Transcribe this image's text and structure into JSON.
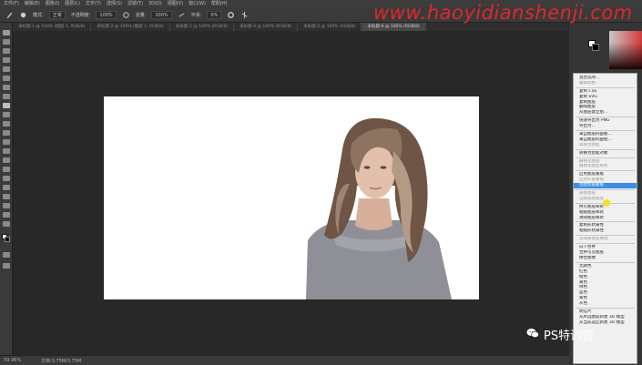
{
  "menubar": {
    "items": [
      "文件(F)",
      "编辑(E)",
      "图像(I)",
      "图层(L)",
      "文字(Y)",
      "选择(S)",
      "滤镜(T)",
      "3D(D)",
      "视图(V)",
      "窗口(W)",
      "帮助(H)"
    ]
  },
  "options": {
    "mode_label": "模式:",
    "mode_value": "正常",
    "opacity_label": "不透明度:",
    "opacity_value": "100%",
    "flow_label": "流量:",
    "flow_value": "100%",
    "smooth_label": "平滑:",
    "smooth_value": "0%"
  },
  "tabs": [
    {
      "label": "未标题-1 @ 100% (图层 1, RGB/8)",
      "active": false
    },
    {
      "label": "未标题-2 @ 100% (图层 1, RGB/8)",
      "active": false
    },
    {
      "label": "未标题-3 @ 100% (RGB/8)",
      "active": false
    },
    {
      "label": "未标题-4 @ 100% (RGB/8)",
      "active": false
    },
    {
      "label": "未标题-5 @ 100% (RGB/8)",
      "active": false
    },
    {
      "label": "未标题-6 @ 100% (RGB/8)",
      "active": true
    }
  ],
  "context_menu": {
    "items": [
      {
        "label": "混合选项...",
        "state": "normal"
      },
      {
        "label": "编辑调整...",
        "state": "disabled"
      },
      {
        "sep": true
      },
      {
        "label": "复制 CSS",
        "state": "normal"
      },
      {
        "label": "复制 SVG",
        "state": "normal"
      },
      {
        "label": "复制图层",
        "state": "normal"
      },
      {
        "label": "删除图层",
        "state": "normal"
      },
      {
        "label": "从图层建立组...",
        "state": "normal"
      },
      {
        "sep": true
      },
      {
        "label": "快速导出为 PNG",
        "state": "normal"
      },
      {
        "label": "导出为...",
        "state": "normal"
      },
      {
        "sep": true
      },
      {
        "label": "来自图层的画板...",
        "state": "normal"
      },
      {
        "label": "来自图层的画框...",
        "state": "normal"
      },
      {
        "label": "转换为图框",
        "state": "disabled"
      },
      {
        "sep": true
      },
      {
        "label": "转换为智能对象",
        "state": "normal"
      },
      {
        "sep": true
      },
      {
        "label": "栅格化图层",
        "state": "disabled"
      },
      {
        "label": "栅格化图层样式",
        "state": "disabled"
      },
      {
        "sep": true
      },
      {
        "label": "启用图层蒙版",
        "state": "normal"
      },
      {
        "label": "启用矢量蒙版",
        "state": "disabled"
      },
      {
        "label": "创建剪贴蒙版",
        "state": "highlighted"
      },
      {
        "sep": true
      },
      {
        "label": "链接图层",
        "state": "disabled"
      },
      {
        "label": "选择链接图层",
        "state": "disabled"
      },
      {
        "sep": true
      },
      {
        "label": "拷贝图层样式",
        "state": "normal"
      },
      {
        "label": "粘贴图层样式",
        "state": "normal"
      },
      {
        "label": "清除图层样式",
        "state": "normal"
      },
      {
        "sep": true
      },
      {
        "label": "复制形状属性",
        "state": "normal"
      },
      {
        "label": "粘贴形状属性",
        "state": "normal"
      },
      {
        "sep": true
      },
      {
        "label": "从隔离图层释放",
        "state": "disabled"
      },
      {
        "sep": true
      },
      {
        "label": "向下合并",
        "state": "normal"
      },
      {
        "label": "合并可见图层",
        "state": "normal"
      },
      {
        "label": "拼合图像",
        "state": "normal"
      },
      {
        "sep": true
      },
      {
        "label": "无颜色",
        "state": "normal"
      },
      {
        "label": "红色",
        "state": "normal"
      },
      {
        "label": "橙色",
        "state": "normal"
      },
      {
        "label": "黄色",
        "state": "normal"
      },
      {
        "label": "绿色",
        "state": "normal"
      },
      {
        "label": "蓝色",
        "state": "normal"
      },
      {
        "label": "紫色",
        "state": "normal"
      },
      {
        "label": "灰色",
        "state": "normal"
      },
      {
        "sep": true
      },
      {
        "label": "明信片",
        "state": "normal"
      },
      {
        "label": "从所选图层新建 3D 模型",
        "state": "normal"
      },
      {
        "label": "从当前选区新建 3D 模型",
        "state": "normal"
      }
    ]
  },
  "status": {
    "zoom": "59.96%",
    "doc": "文档:3.75M/3.75M"
  },
  "watermark": "www.haoyidianshenji.com",
  "brand": "PS特训营",
  "colors": {
    "canvas_bg": "#282828",
    "panel": "#3a3a3a",
    "highlight": "#3a8ee6",
    "watermark": "#e0282a"
  }
}
